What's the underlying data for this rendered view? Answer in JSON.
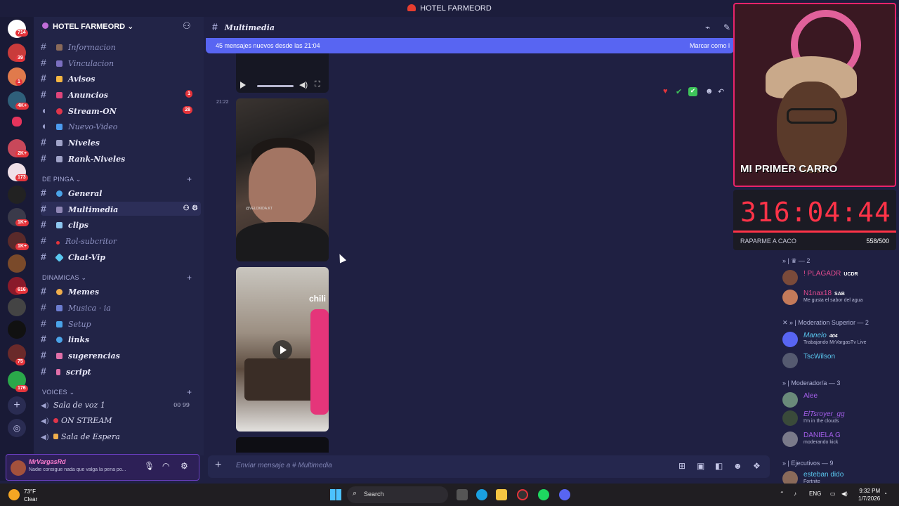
{
  "window": {
    "title": "HOTEL FARMEORD"
  },
  "servers": {
    "badges": [
      "714",
      "39",
      "1",
      "4K+",
      "2K+",
      "173",
      "1K+",
      "1K+",
      "616",
      "75",
      "176"
    ]
  },
  "sidebar": {
    "guild_name": "HOTEL FARMEORD",
    "channels_top": [
      {
        "label": "Informacion",
        "dim": true,
        "color": "#8a6a5a"
      },
      {
        "label": "Vinculacion",
        "dim": true,
        "color": "#7b6fc0"
      },
      {
        "label": "Avisos",
        "dim": false,
        "color": "#f5b642"
      },
      {
        "label": "Anuncios",
        "dim": false,
        "color": "#e0457b",
        "badge": "1"
      },
      {
        "label": "Stream-ON",
        "dim": false,
        "color": "#e0354a",
        "badge": "28"
      },
      {
        "label": "Nuevo-Video",
        "dim": true,
        "color": "#4c9bef"
      },
      {
        "label": "Niveles",
        "dim": false,
        "color": "#a0a3c8"
      },
      {
        "label": "Rank-Niveles",
        "dim": false,
        "color": "#a0a3c8"
      }
    ],
    "category1": "DE PINGA",
    "channels_mid": [
      {
        "label": "General",
        "dim": false,
        "color": "#4aa3e8"
      },
      {
        "label": "Multimedia",
        "dim": false,
        "color": "#8f86b5",
        "active": true
      },
      {
        "label": "clips",
        "dim": false,
        "color": "#8ec7f0"
      },
      {
        "label": "Rol-subcritor",
        "dim": true,
        "color": "#e5343b"
      },
      {
        "label": "Chat-Vip",
        "dim": false,
        "color": "#5ac8f0"
      }
    ],
    "category2": "DINAMICAS",
    "channels_low": [
      {
        "label": "Memes",
        "dim": false,
        "color": "#f0ae4c"
      },
      {
        "label": "Musica · ia",
        "dim": true,
        "color": "#6c7dd0"
      },
      {
        "label": "Setup",
        "dim": true,
        "color": "#4aa3e8"
      },
      {
        "label": "links",
        "dim": false,
        "color": "#4aa3e8"
      },
      {
        "label": "sugerencias",
        "dim": false,
        "color": "#e06fa8"
      },
      {
        "label": "script",
        "dim": false,
        "color": "#e06fa8"
      }
    ],
    "category3": "VOICES",
    "voice": [
      {
        "label": "Sala de voz 1",
        "nums": "00 99"
      },
      {
        "label": "ON STREAM",
        "nums": ""
      },
      {
        "label": "Sala de Espera",
        "nums": ""
      }
    ]
  },
  "user": {
    "name": "MrVargasRd",
    "status": "Nadie consigue nada que valga la pena po..."
  },
  "channel": {
    "name": "Multimedia"
  },
  "newbar": {
    "text": "45 mensajes nuevos desde las 21:04",
    "action": "Marcar como l"
  },
  "messages": {
    "timestamp": "21:22",
    "watermark": "@VELOKIDA.KT",
    "sign": "chili"
  },
  "composer": {
    "placeholder": "Enviar mensaje a #  Multimedia"
  },
  "stream": {
    "overlay_text": "MI PRIMER CARRO",
    "timer": "316:04:44",
    "goal_label": "RAPARME A CACO",
    "goal_count": "558/500"
  },
  "members": {
    "group1": "— 2",
    "list1": [
      {
        "name": "! PLAGADR",
        "tag": "UCDR",
        "status": "",
        "color": "#e34b8f"
      },
      {
        "name": "N1nax18",
        "tag": "SAB",
        "status": "Me gusta el sabor del agua",
        "color": "#e34b8f"
      }
    ],
    "group2": "Moderation Superior — 2",
    "list2": [
      {
        "name": "Manelo",
        "tag": "404",
        "status": "Trabajando MrVargasTv Live",
        "color": "#5ac8f0"
      },
      {
        "name": "TscWilson",
        "tag": "",
        "status": "",
        "color": "#5ac8f0"
      }
    ],
    "group3": "Moderador/a — 3",
    "list3": [
      {
        "name": "Alee",
        "tag": "",
        "status": "",
        "color": "#a35ee8"
      },
      {
        "name": "ElTsroyer_gg",
        "tag": "",
        "status": "I'm in the clouds",
        "color": "#a35ee8"
      },
      {
        "name": "DANIELA G",
        "tag": "",
        "status": "moderando kick",
        "color": "#a35ee8"
      }
    ],
    "group4": "Ejecutivos — 9",
    "list4": [
      {
        "name": "esteban dido",
        "tag": "",
        "status": "Fortnite",
        "color": "#5ac8f0"
      }
    ]
  },
  "taskbar": {
    "temp": "73°F",
    "weather": "Clear",
    "search": "Search",
    "lang": "ENG",
    "time": "9:32 PM",
    "date": "1/7/2026"
  }
}
